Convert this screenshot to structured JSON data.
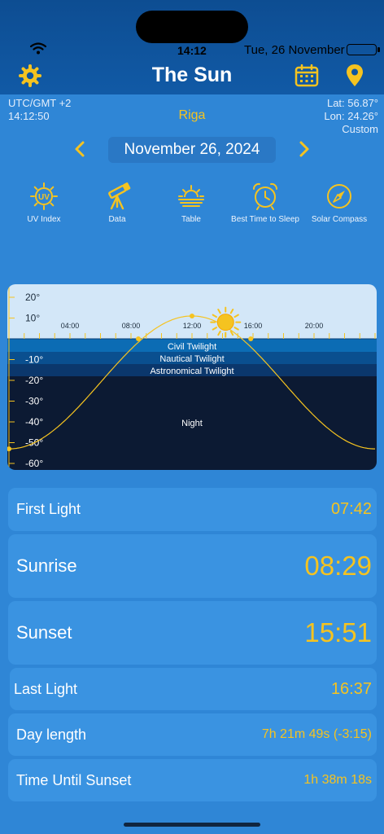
{
  "status": {
    "time": "14:12",
    "date": "Tue, 26 November"
  },
  "header": {
    "title": "The Sun"
  },
  "location": {
    "utc": "UTC/GMT +2",
    "local_time": "14:12:50",
    "city": "Riga",
    "lat": "Lat: 56.87°",
    "lon": "Lon: 24.26°",
    "mode": "Custom"
  },
  "date_nav": {
    "date": "November 26, 2024"
  },
  "tools": [
    {
      "label": "UV Index",
      "icon": "uv-index-icon"
    },
    {
      "label": "Data",
      "icon": "telescope-icon"
    },
    {
      "label": "Table",
      "icon": "sunrise-table-icon"
    },
    {
      "label": "Best Time to Sleep",
      "icon": "alarm-clock-icon"
    },
    {
      "label": "Solar Compass",
      "icon": "compass-icon"
    }
  ],
  "chart": {
    "y_ticks": [
      "20°",
      "10°",
      "-10°",
      "-20°",
      "-30°",
      "-40°",
      "-50°",
      "-60°"
    ],
    "x_ticks": [
      "04:00",
      "08:00",
      "12:00",
      "16:00",
      "20:00"
    ],
    "bands": [
      "Civil Twilight",
      "Nautical Twilight",
      "Astronomical Twilight",
      "Night"
    ],
    "colors": {
      "day": "#d3e7f8",
      "civil": "#0c6cb4",
      "nautical": "#0a4f8f",
      "astro": "#0b376c",
      "night": "#0c1a33",
      "curve": "#f5c320"
    }
  },
  "chart_data": {
    "type": "line",
    "x": [
      "00:00",
      "04:00",
      "08:00",
      "08:29",
      "12:00",
      "15:51",
      "16:00",
      "20:00",
      "24:00"
    ],
    "values": [
      -53,
      -38,
      -5,
      0,
      11,
      0,
      -1,
      -36,
      -53
    ],
    "current_time": "14:12",
    "current_elevation": 8,
    "xlim": [
      "00:00",
      "24:00"
    ],
    "ylim": [
      -60,
      25
    ]
  },
  "rows": [
    {
      "label": "First Light",
      "value": "07:42"
    },
    {
      "label": "Sunrise",
      "value": "08:29"
    },
    {
      "label": "Sunset",
      "value": "15:51"
    },
    {
      "label": "Last Light",
      "value": "16:37"
    },
    {
      "label": "Day length",
      "value": "7h 21m 49s (-3:15)"
    },
    {
      "label": "Time Until Sunset",
      "value": "1h 38m 18s"
    }
  ]
}
